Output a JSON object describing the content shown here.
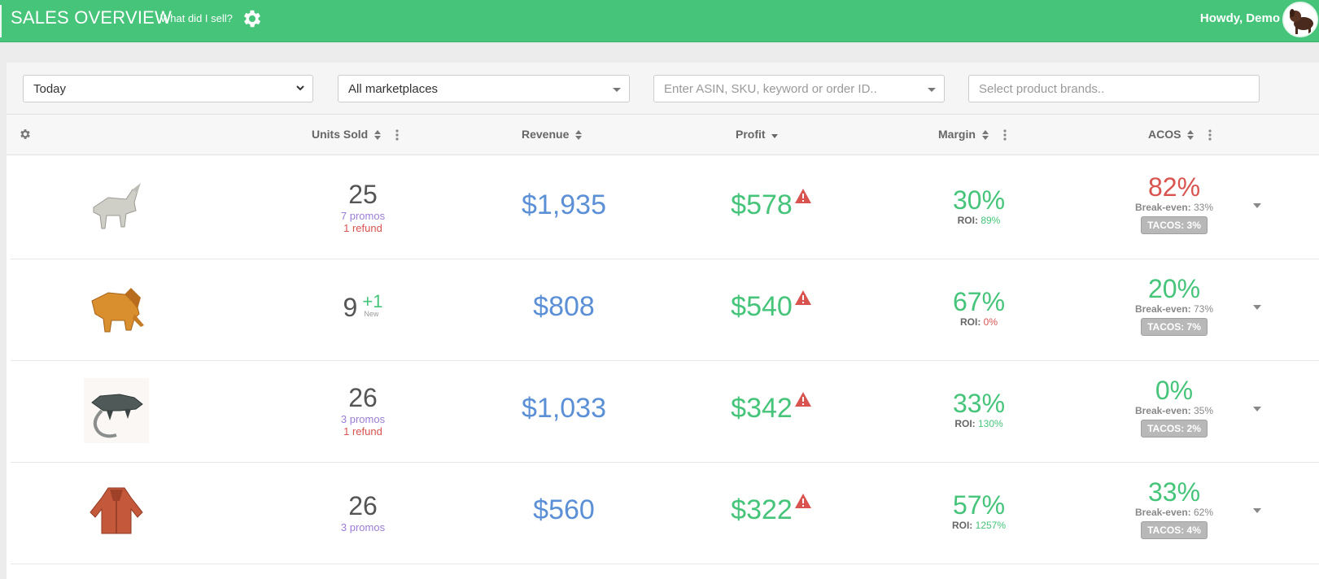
{
  "header": {
    "title": "SALES OVERVIEW",
    "subtitle": "What did I sell?",
    "greeting": "Howdy, Demo"
  },
  "filters": {
    "period": "Today",
    "marketplace": "All marketplaces",
    "search_placeholder": "Enter ASIN, SKU, keyword or order ID..",
    "brands_placeholder": "Select product brands.."
  },
  "columns": {
    "units": "Units Sold",
    "revenue": "Revenue",
    "profit": "Profit",
    "margin": "Margin",
    "acos": "ACOS"
  },
  "labels": {
    "roi": "ROI: ",
    "break_even": "Break-even: ",
    "new": "New"
  },
  "rows": [
    {
      "units": "25",
      "promos": "7 promos",
      "refund": "1 refund",
      "revenue": "$1,935",
      "profit": "$578",
      "margin": "30%",
      "roi": "89%",
      "acos": "82%",
      "break_even": "33%",
      "tacos": "TACOS: 3%"
    },
    {
      "units": "9",
      "new_units": "+1",
      "revenue": "$808",
      "profit": "$540",
      "margin": "67%",
      "roi": "0%",
      "acos": "20%",
      "break_even": "73%",
      "tacos": "TACOS: 7%"
    },
    {
      "units": "26",
      "promos": "3 promos",
      "refund": "1 refund",
      "revenue": "$1,033",
      "profit": "$342",
      "margin": "33%",
      "roi": "130%",
      "acos": "0%",
      "break_even": "35%",
      "tacos": "TACOS: 2%"
    },
    {
      "units": "26",
      "promos": "3 promos",
      "revenue": "$560",
      "profit": "$322",
      "margin": "57%",
      "roi": "1257%",
      "acos": "33%",
      "break_even": "62%",
      "tacos": "TACOS: 4%"
    }
  ],
  "colors": {
    "brand_green": "#45c47a",
    "revenue_blue": "#5b8fd6",
    "danger_red": "#d9534f",
    "promo_purple": "#9b7cd6"
  },
  "icons": {
    "settings": "gear-icon",
    "sort": "sort-icon",
    "column_menu": "kebab-icon",
    "warning": "warning-triangle-icon",
    "expand": "caret-down-icon"
  }
}
